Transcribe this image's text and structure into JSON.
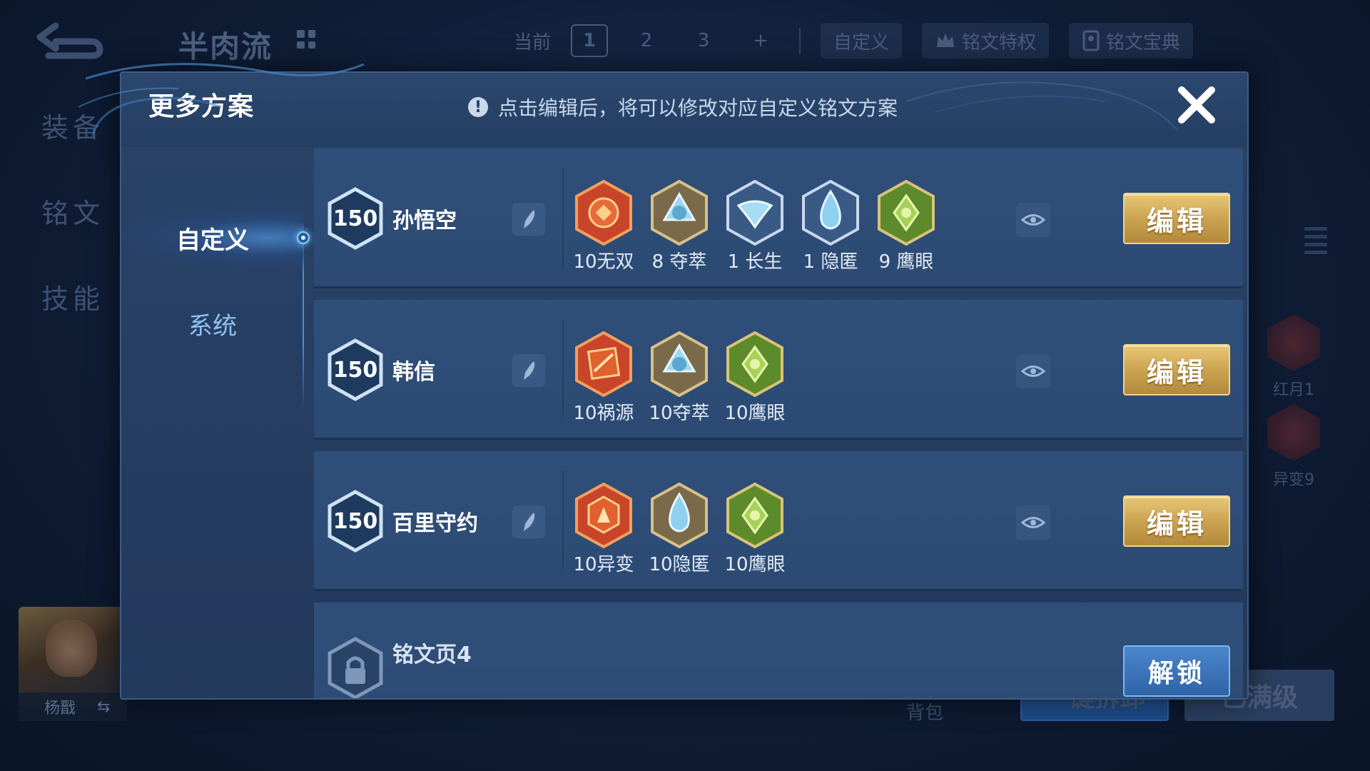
{
  "background": {
    "title": "半肉流",
    "top_tabs": [
      {
        "label": "当前",
        "boxed": false
      },
      {
        "label": "1",
        "boxed": true
      },
      {
        "label": "2",
        "boxed": false
      },
      {
        "label": "3",
        "boxed": false
      },
      {
        "label": "+",
        "boxed": false
      }
    ],
    "custom_label": "自定义",
    "privilege_label": "铭文特权",
    "guide_label": "铭文宝典",
    "side_tabs": [
      "装备",
      "铭文",
      "技能"
    ],
    "hero_name": "杨戬",
    "right_icons": [
      {
        "label": "红月1",
        "color": "#7a2a2a"
      },
      {
        "label": "异变9",
        "color": "#7a2a2a"
      }
    ],
    "bag_label": "背包",
    "bottom_left_button": "一键拆卸",
    "bottom_right_button": "已满级"
  },
  "modal": {
    "title": "更多方案",
    "hint": "点击编辑后，将可以修改对应自定义铭文方案",
    "nav": [
      {
        "label": "自定义",
        "active": true
      },
      {
        "label": "系统",
        "active": false
      }
    ],
    "plans": [
      {
        "level": "150",
        "name": "孙悟空",
        "edit_label": "编辑",
        "runes": [
          {
            "label": "10无双",
            "icon": "wushuang-rune-icon",
            "color": "red"
          },
          {
            "label": "8 夺萃",
            "icon": "duocui-rune-icon",
            "color": "blue"
          },
          {
            "label": "1 长生",
            "icon": "changsheng-rune-icon",
            "color": "blue"
          },
          {
            "label": "1 隐匿",
            "icon": "yinni-rune-icon",
            "color": "blue"
          },
          {
            "label": "9 鹰眼",
            "icon": "yingyan-rune-icon",
            "color": "green"
          }
        ]
      },
      {
        "level": "150",
        "name": "韩信",
        "edit_label": "编辑",
        "runes": [
          {
            "label": "10祸源",
            "icon": "huoyuan-rune-icon",
            "color": "red"
          },
          {
            "label": "10夺萃",
            "icon": "duocui-rune-icon",
            "color": "blue"
          },
          {
            "label": "10鹰眼",
            "icon": "yingyan-rune-icon",
            "color": "green"
          }
        ]
      },
      {
        "level": "150",
        "name": "百里守约",
        "edit_label": "编辑",
        "runes": [
          {
            "label": "10异变",
            "icon": "yibian-rune-icon",
            "color": "red"
          },
          {
            "label": "10隐匿",
            "icon": "yinni-rune-icon",
            "color": "blue"
          },
          {
            "label": "10鹰眼",
            "icon": "yingyan-rune-icon",
            "color": "green"
          }
        ]
      }
    ],
    "locked_page": {
      "name": "铭文页4",
      "unlock_label": "解锁"
    }
  },
  "colors": {
    "gold_button": "#c9a04d",
    "panel": "#2a4368",
    "rune_red": "#d8542a",
    "rune_blue": "#7ec4e6",
    "rune_green": "#7db33a"
  }
}
